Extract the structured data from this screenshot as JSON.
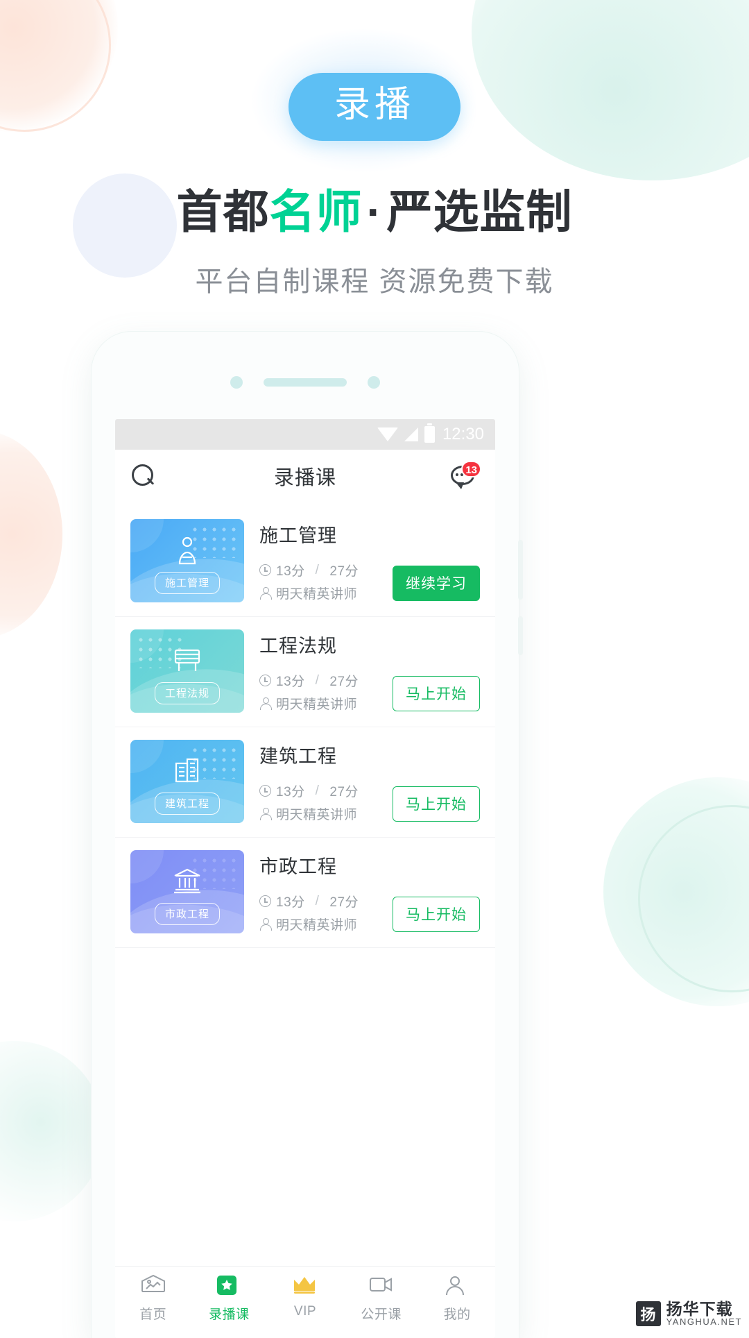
{
  "promo": {
    "badge_label": "录播",
    "headline_pre": "首都",
    "headline_accent": "名师",
    "headline_dot": "·",
    "headline_post": "严选监制",
    "subhead": "平台自制课程 资源免费下载",
    "accent_color": "#00d294",
    "badge_color": "#5dbff4"
  },
  "phone": {
    "statusbar": {
      "time": "12:30",
      "wifi_icon": "wifi-icon",
      "signal_icon": "signal-icon",
      "battery_icon": "battery-icon"
    },
    "header": {
      "search_icon": "search-icon",
      "title": "录播课",
      "message_icon": "message-icon",
      "message_badge": "13"
    },
    "courses": [
      {
        "title": "施工管理",
        "thumb_label": "施工管理",
        "thumb_glyph": "person-icon",
        "duration_watched": "13分",
        "duration_sep": "/",
        "duration_total": "27分",
        "instructor": "明天精英讲师",
        "cta": "继续学习",
        "cta_style": "filled",
        "color_from": "#4aa9f5",
        "color_to": "#6cc6f7"
      },
      {
        "title": "工程法规",
        "thumb_label": "工程法规",
        "thumb_glyph": "barrier-icon",
        "duration_watched": "13分",
        "duration_sep": "/",
        "duration_total": "27分",
        "instructor": "明天精英讲师",
        "cta": "马上开始",
        "cta_style": "outline",
        "color_from": "#5fd1d8",
        "color_to": "#7bd9d6"
      },
      {
        "title": "建筑工程",
        "thumb_label": "建筑工程",
        "thumb_glyph": "building-icon",
        "duration_watched": "13分",
        "duration_sep": "/",
        "duration_total": "27分",
        "instructor": "明天精英讲师",
        "cta": "马上开始",
        "cta_style": "outline",
        "color_from": "#4fb4f2",
        "color_to": "#63c6f0"
      },
      {
        "title": "市政工程",
        "thumb_label": "市政工程",
        "thumb_glyph": "bank-icon",
        "duration_watched": "13分",
        "duration_sep": "/",
        "duration_total": "27分",
        "instructor": "明天精英讲师",
        "cta": "马上开始",
        "cta_style": "outline",
        "color_from": "#7f8ef5",
        "color_to": "#8fa0f7"
      }
    ],
    "tabs": [
      {
        "label": "首页",
        "icon": "home-icon",
        "active": false
      },
      {
        "label": "录播课",
        "icon": "star-box-icon",
        "active": true
      },
      {
        "label": "VIP",
        "icon": "crown-icon",
        "active": false
      },
      {
        "label": "公开课",
        "icon": "video-icon",
        "active": false
      },
      {
        "label": "我的",
        "icon": "user-icon",
        "active": false
      }
    ]
  },
  "watermark": {
    "mark": "扬",
    "cn": "扬华下载",
    "en": "YANGHUA.NET"
  }
}
